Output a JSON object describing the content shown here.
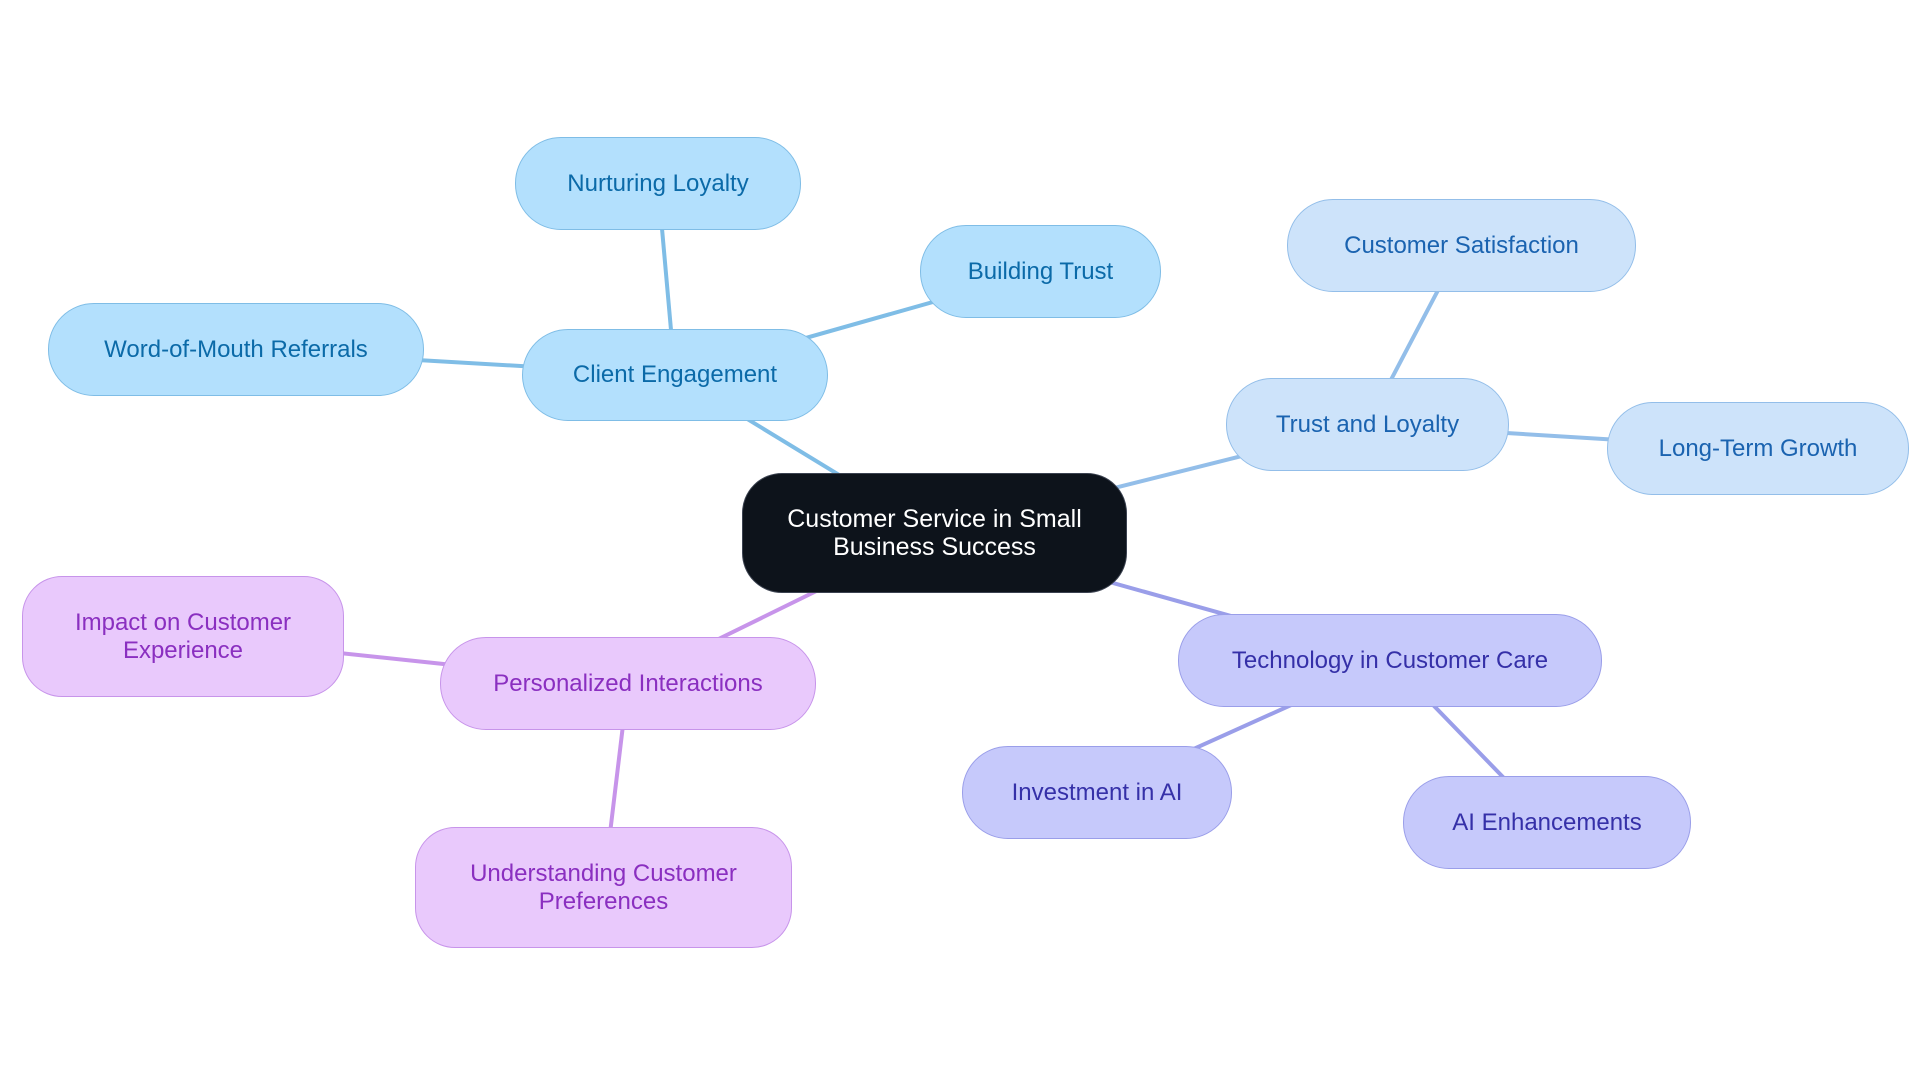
{
  "diagram": {
    "type": "mindmap",
    "root": {
      "id": "root",
      "label": "Customer Service in Small\nBusiness Success"
    },
    "branches": [
      {
        "id": "client-engagement",
        "label": "Client Engagement",
        "color": {
          "fill": "#b3e0fd",
          "stroke": "#7fbde6",
          "text": "#0b6aa8",
          "edge": "#7fbde6"
        },
        "children": [
          {
            "id": "nurturing-loyalty",
            "label": "Nurturing Loyalty"
          },
          {
            "id": "building-trust",
            "label": "Building Trust"
          },
          {
            "id": "word-of-mouth-referrals",
            "label": "Word-of-Mouth Referrals"
          }
        ]
      },
      {
        "id": "trust-and-loyalty",
        "label": "Trust and Loyalty",
        "color": {
          "fill": "#cde3fa",
          "stroke": "#93bee9",
          "text": "#1a63b0",
          "edge": "#93bee9"
        },
        "children": [
          {
            "id": "customer-satisfaction",
            "label": "Customer Satisfaction"
          },
          {
            "id": "long-term-growth",
            "label": "Long-Term Growth"
          }
        ]
      },
      {
        "id": "technology-in-customer-care",
        "label": "Technology in Customer Care",
        "color": {
          "fill": "#c6c9fb",
          "stroke": "#9a9ee9",
          "text": "#3530a8",
          "edge": "#9a9ee9"
        },
        "children": [
          {
            "id": "investment-in-ai",
            "label": "Investment in AI"
          },
          {
            "id": "ai-enhancements",
            "label": "AI Enhancements"
          }
        ]
      },
      {
        "id": "personalized-interactions",
        "label": "Personalized Interactions",
        "color": {
          "fill": "#e9c9fc",
          "stroke": "#c794ea",
          "text": "#8a2fc0",
          "edge": "#c794ea"
        },
        "children": [
          {
            "id": "impact-on-customer-experience",
            "label": "Impact on Customer\nExperience"
          },
          {
            "id": "understanding-customer-preferences",
            "label": "Understanding Customer\nPreferences"
          }
        ]
      }
    ],
    "root_color": {
      "fill": "#0d131b",
      "text": "#ffffff"
    }
  }
}
